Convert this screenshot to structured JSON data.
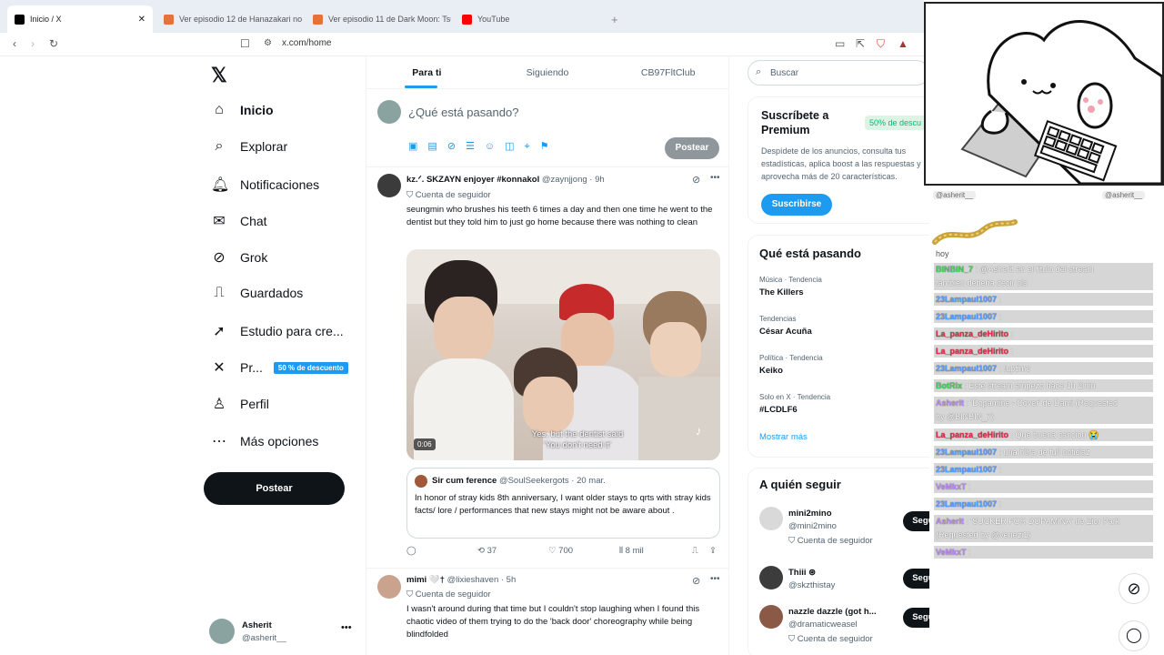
{
  "browser": {
    "tabs": [
      {
        "title": "Inicio / X",
        "active": true
      },
      {
        "title": "Ver episodio 12 de Hanazakari no Ki"
      },
      {
        "title": "Ver episodio 11 de Dark Moon: Tsuk"
      },
      {
        "title": "YouTube"
      }
    ],
    "url": "x.com/home"
  },
  "sidebar": {
    "items": [
      {
        "label": "Inicio",
        "icon": "home-icon"
      },
      {
        "label": "Explorar",
        "icon": "search-icon"
      },
      {
        "label": "Notificaciones",
        "icon": "bell-icon"
      },
      {
        "label": "Chat",
        "icon": "mail-icon"
      },
      {
        "label": "Grok",
        "icon": "grok-icon"
      },
      {
        "label": "Guardados",
        "icon": "bookmark-icon"
      },
      {
        "label": "Estudio para cre...",
        "icon": "rocket-icon"
      },
      {
        "label": "Pr...",
        "icon": "x-logo-icon"
      },
      {
        "label": "Perfil",
        "icon": "person-icon"
      },
      {
        "label": "Más opciones",
        "icon": "more-circle-icon"
      }
    ],
    "premium_badge": "50 % de descuento",
    "post_button": "Postear",
    "account": {
      "name": "Asherit",
      "handle": "@asherit__"
    }
  },
  "timeline": {
    "tabs": [
      "Para ti",
      "Siguiendo",
      "CB97FltClub"
    ],
    "compose_placeholder": "¿Qué está pasando?",
    "compose_button": "Postear",
    "tweets": [
      {
        "name": "kz.ᐟ. SKZAYN enjoyer #konnakol",
        "handle": "@zaynjjong",
        "time": "· 9h",
        "label": "Cuenta de seguidor",
        "text": "seungmin who brushes his teeth 6 times a day and then one time he went to the dentist but they told him to just go home because there was nothing to clean",
        "video": {
          "duration": "0:06",
          "subtitle1": "Yes, but the dentist said",
          "subtitle2": "'You don't need it'"
        },
        "quote": {
          "name": "Sir cum ference",
          "handle": "@SoulSeekergots",
          "time": "· 20 mar.",
          "text": "In honor of stray kids 8th anniversary, I want older stays to qrts with stray kids facts/ lore / performances that new stays might not be aware about ."
        },
        "reposts": "37",
        "likes": "700",
        "views": "8 mil"
      },
      {
        "name": "mimi 🤍†",
        "handle": "@lixieshaven",
        "time": "· 5h",
        "label": "Cuenta de seguidor",
        "text": "I wasn't around during that time but I couldn't stop laughing when I found this chaotic video of them trying to do the 'back door' choreography while being blindfolded"
      }
    ]
  },
  "right": {
    "search_placeholder": "Buscar",
    "premium": {
      "title": "Suscríbete a Premium",
      "badge": "50% de descu",
      "text": "Despídete de los anuncios, consulta tus estadísticas, aplica boost a las respuestas y aprovecha más de 20 características.",
      "button": "Suscribirse"
    },
    "trends": {
      "title": "Qué está pasando",
      "items": [
        {
          "context": "Música · Tendencia",
          "name": "The Killers"
        },
        {
          "context": "Tendencias",
          "name": "César Acuña"
        },
        {
          "context": "Política · Tendencia",
          "name": "Keiko"
        },
        {
          "context": "Solo en X · Tendencia",
          "name": "#LCDLF6"
        }
      ],
      "more": "Mostrar más"
    },
    "follow": {
      "title": "A quién seguir",
      "items": [
        {
          "name": "mini2mino",
          "handle": "@mini2mino",
          "sub": "Cuenta de seguidor",
          "button": "Seguir"
        },
        {
          "name": "Thiii ⊛",
          "handle": "@skzthistay",
          "sub": "",
          "button": "Seguir"
        },
        {
          "name": "nazzle dazzle (got h...",
          "handle": "@dramaticweasel",
          "sub": "Cuenta de seguidor",
          "button": "Seguir"
        }
      ]
    }
  },
  "overlay": {
    "top_left_user": "@asherit__",
    "top_right_user": "@asherit__",
    "chat": [
      {
        "user": "",
        "msg": "hoy"
      },
      {
        "user": "BINBIN_7",
        "msg": ": @Asherit en el titulo del stream"
      },
      {
        "user": "",
        "msg": "tambien deberia decir bls"
      },
      {
        "user": "23Lampaul1007",
        "msg": ":"
      },
      {
        "user": "23Lampaul1007",
        "msg": ":"
      },
      {
        "user": "La_panza_deHirito",
        "msg": ":"
      },
      {
        "user": "La_panza_deHirito",
        "msg": ":"
      },
      {
        "user": "23Lampaul1007",
        "msg": ": !uptime"
      },
      {
        "user": "BotRix",
        "msg": ": Este stream empezo hace 1h 2min"
      },
      {
        "user": "Asherit",
        "msg": ": 'Dopamine - Cover' de Dami (Requested"
      },
      {
        "user": "",
        "msg": "by @BINBIN_7)"
      },
      {
        "user": "La_panza_deHirito",
        "msg": ": Que buena cancion 😭"
      },
      {
        "user": "23Lampaul1007",
        "msg": ": una h0ra de full noticiaz"
      },
      {
        "user": "23Lampaul1007",
        "msg": ":"
      },
      {
        "user": "VeMkxT",
        "msg": ":"
      },
      {
        "user": "23Lampaul1007",
        "msg": ":"
      },
      {
        "user": "Asherit",
        "msg": ": 'SUCKER FOR DOPAMINA' de Zior Park"
      },
      {
        "user": "",
        "msg": "(Requested by @venezi1)"
      },
      {
        "user": "VeMkxT",
        "msg": ":"
      }
    ]
  }
}
